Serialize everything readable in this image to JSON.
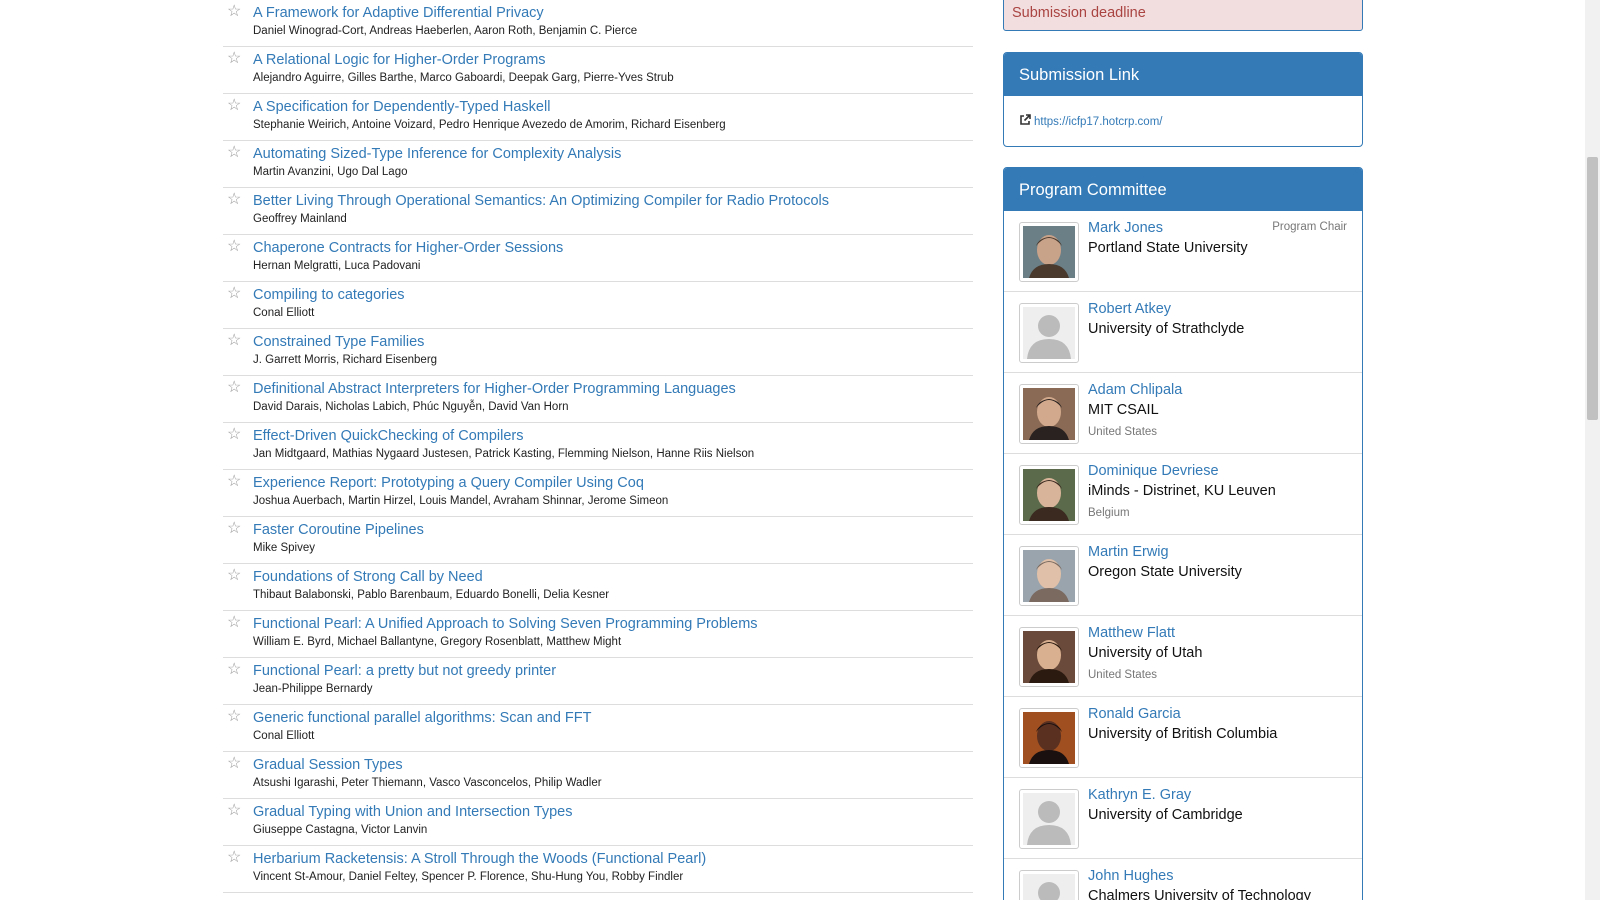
{
  "papers": [
    {
      "title": "A Framework for Adaptive Differential Privacy",
      "authors": "Daniel Winograd-Cort, Andreas Haeberlen, Aaron Roth, Benjamin C. Pierce"
    },
    {
      "title": "A Relational Logic for Higher-Order Programs",
      "authors": "Alejandro Aguirre, Gilles Barthe, Marco Gaboardi, Deepak Garg, Pierre-Yves Strub"
    },
    {
      "title": "A Specification for Dependently-Typed Haskell",
      "authors": "Stephanie Weirich, Antoine Voizard, Pedro Henrique Avezedo de Amorim, Richard Eisenberg"
    },
    {
      "title": "Automating Sized-Type Inference for Complexity Analysis",
      "authors": "Martin Avanzini, Ugo Dal Lago"
    },
    {
      "title": "Better Living Through Operational Semantics: An Optimizing Compiler for Radio Protocols",
      "authors": "Geoffrey Mainland"
    },
    {
      "title": "Chaperone Contracts for Higher-Order Sessions",
      "authors": "Hernan Melgratti, Luca Padovani"
    },
    {
      "title": "Compiling to categories",
      "authors": "Conal Elliott"
    },
    {
      "title": "Constrained Type Families",
      "authors": "J. Garrett Morris, Richard Eisenberg"
    },
    {
      "title": "Definitional Abstract Interpreters for Higher-Order Programming Languages",
      "authors": "David Darais, Nicholas Labich, Phúc Nguyễn, David Van Horn"
    },
    {
      "title": "Effect-Driven QuickChecking of Compilers",
      "authors": "Jan Midtgaard, Mathias Nygaard Justesen, Patrick Kasting, Flemming Nielson, Hanne Riis Nielson"
    },
    {
      "title": "Experience Report: Prototyping a Query Compiler Using Coq",
      "authors": "Joshua Auerbach, Martin Hirzel, Louis Mandel, Avraham Shinnar, Jerome Simeon"
    },
    {
      "title": "Faster Coroutine Pipelines",
      "authors": "Mike Spivey"
    },
    {
      "title": "Foundations of Strong Call by Need",
      "authors": "Thibaut Balabonski, Pablo Barenbaum, Eduardo Bonelli, Delia Kesner"
    },
    {
      "title": "Functional Pearl: A Unified Approach to Solving Seven Programming Problems",
      "authors": "William E. Byrd, Michael Ballantyne, Gregory Rosenblatt, Matthew Might"
    },
    {
      "title": "Functional Pearl: a pretty but not greedy printer",
      "authors": "Jean-Philippe Bernardy"
    },
    {
      "title": "Generic functional parallel algorithms: Scan and FFT",
      "authors": "Conal Elliott"
    },
    {
      "title": "Gradual Session Types",
      "authors": "Atsushi Igarashi, Peter Thiemann, Vasco Vasconcelos, Philip Wadler"
    },
    {
      "title": "Gradual Typing with Union and Intersection Types",
      "authors": "Giuseppe Castagna, Victor Lanvin"
    },
    {
      "title": "Herbarium Racketensis: A Stroll Through the Woods (Functional Pearl)",
      "authors": "Vincent St-Amour, Daniel Feltey, Spencer P. Florence, Shu-Hung You, Robby Findler"
    }
  ],
  "icons": {
    "star": "☆",
    "external_link": "external-link-icon"
  },
  "sidebar": {
    "deadline_label": "Submission deadline",
    "submission_link": {
      "heading": "Submission Link",
      "url": "https://icfp17.hotcrp.com/"
    },
    "pc": {
      "heading": "Program Committee",
      "members": [
        {
          "name": "Mark Jones",
          "affiliation": "Portland State University",
          "country": "",
          "role": "Program Chair",
          "photo": "photo"
        },
        {
          "name": "Robert Atkey",
          "affiliation": "University of Strathclyde",
          "country": "",
          "role": "",
          "photo": "placeholder"
        },
        {
          "name": "Adam Chlipala",
          "affiliation": "MIT CSAIL",
          "country": "United States",
          "role": "",
          "photo": "photo"
        },
        {
          "name": "Dominique Devriese",
          "affiliation": "iMinds - Distrinet, KU Leuven",
          "country": "Belgium",
          "role": "",
          "photo": "photo"
        },
        {
          "name": "Martin Erwig",
          "affiliation": "Oregon State University",
          "country": "",
          "role": "",
          "photo": "photo"
        },
        {
          "name": "Matthew Flatt",
          "affiliation": "University of Utah",
          "country": "United States",
          "role": "",
          "photo": "photo"
        },
        {
          "name": "Ronald Garcia",
          "affiliation": "University of British Columbia",
          "country": "",
          "role": "",
          "photo": "photo"
        },
        {
          "name": "Kathryn E. Gray",
          "affiliation": "University of Cambridge",
          "country": "",
          "role": "",
          "photo": "placeholder"
        },
        {
          "name": "John Hughes",
          "affiliation": "Chalmers University of Technology",
          "country": "",
          "role": "",
          "photo": "placeholder"
        }
      ]
    }
  },
  "colors": {
    "link": "#337ab7",
    "panel_heading": "#337ab7",
    "deadline_bg": "#f2dede",
    "deadline_text": "#a94442"
  }
}
